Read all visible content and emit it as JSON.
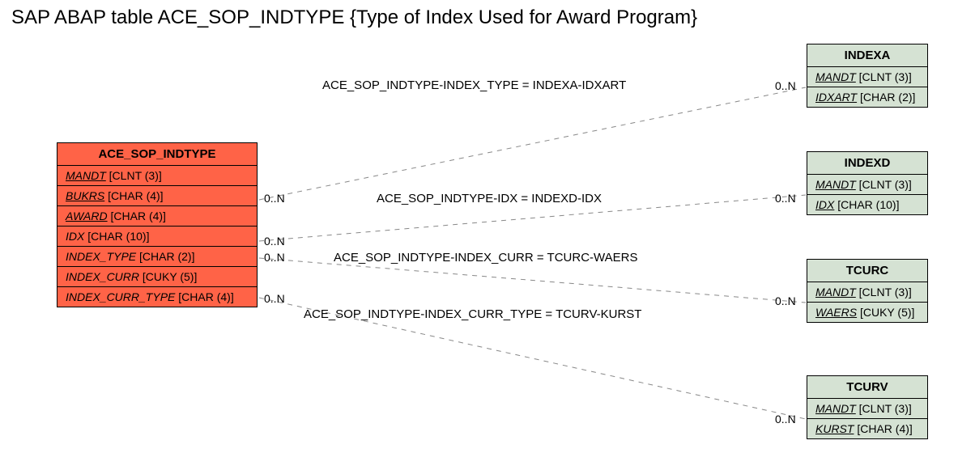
{
  "title": "SAP ABAP table ACE_SOP_INDTYPE {Type of Index Used for Award Program}",
  "main": {
    "name": "ACE_SOP_INDTYPE",
    "fields": [
      {
        "pre": "MANDT",
        "type": " [CLNT (3)]",
        "style": "fk"
      },
      {
        "pre": "BUKRS",
        "type": " [CHAR (4)]",
        "style": "fk"
      },
      {
        "pre": "AWARD",
        "type": " [CHAR (4)]",
        "style": "fk"
      },
      {
        "pre": "IDX",
        "type": " [CHAR (10)]",
        "style": "ital"
      },
      {
        "pre": "INDEX_TYPE",
        "type": " [CHAR (2)]",
        "style": "ital"
      },
      {
        "pre": "INDEX_CURR",
        "type": " [CUKY (5)]",
        "style": "ital"
      },
      {
        "pre": "INDEX_CURR_TYPE",
        "type": " [CHAR (4)]",
        "style": "ital"
      }
    ]
  },
  "refs": [
    {
      "name": "INDEXA",
      "fields": [
        {
          "pre": "MANDT",
          "type": " [CLNT (3)]",
          "style": "fk"
        },
        {
          "pre": "IDXART",
          "type": " [CHAR (2)]",
          "style": "fk"
        }
      ]
    },
    {
      "name": "INDEXD",
      "fields": [
        {
          "pre": "MANDT",
          "type": " [CLNT (3)]",
          "style": "fk"
        },
        {
          "pre": "IDX",
          "type": " [CHAR (10)]",
          "style": "fk"
        }
      ]
    },
    {
      "name": "TCURC",
      "fields": [
        {
          "pre": "MANDT",
          "type": " [CLNT (3)]",
          "style": "fk"
        },
        {
          "pre": "WAERS",
          "type": " [CUKY (5)]",
          "style": "fk"
        }
      ]
    },
    {
      "name": "TCURV",
      "fields": [
        {
          "pre": "MANDT",
          "type": " [CLNT (3)]",
          "style": "fk"
        },
        {
          "pre": "KURST",
          "type": " [CHAR (4)]",
          "style": "fk"
        }
      ]
    }
  ],
  "rels": [
    {
      "label": "ACE_SOP_INDTYPE-INDEX_TYPE = INDEXA-IDXART"
    },
    {
      "label": "ACE_SOP_INDTYPE-IDX = INDEXD-IDX"
    },
    {
      "label": "ACE_SOP_INDTYPE-INDEX_CURR = TCURC-WAERS"
    },
    {
      "label": "ACE_SOP_INDTYPE-INDEX_CURR_TYPE = TCURV-KURST"
    }
  ],
  "card": "0..N"
}
